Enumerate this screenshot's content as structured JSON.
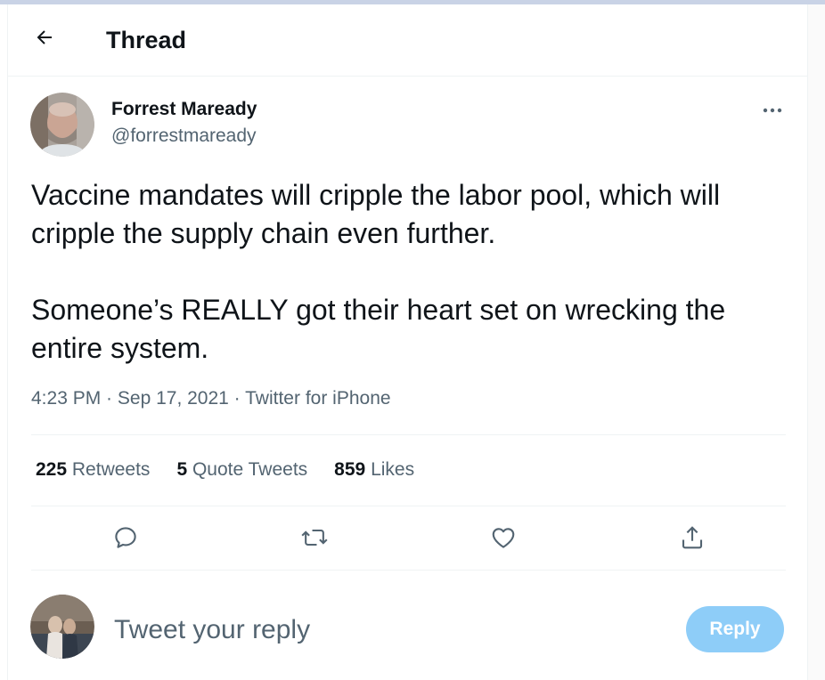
{
  "header": {
    "title": "Thread",
    "back_icon": "arrow-left-icon"
  },
  "tweet": {
    "author_name": "Forrest Maready",
    "author_handle": "@forrestmaready",
    "text_paragraphs": [
      "Vaccine mandates will cripple the labor pool, which will cripple the supply chain even further.",
      "Someone’s REALLY got their heart set on wrecking the entire system."
    ],
    "time": "4:23 PM",
    "date": "Sep 17, 2021",
    "separator": " · ",
    "source": "Twitter for iPhone"
  },
  "stats": {
    "retweets_count": "225",
    "retweets_label": "Retweets",
    "quotes_count": "5",
    "quotes_label": "Quote Tweets",
    "likes_count": "859",
    "likes_label": "Likes"
  },
  "actions": {
    "reply_icon": "reply-icon",
    "retweet_icon": "retweet-icon",
    "like_icon": "heart-icon",
    "share_icon": "share-icon"
  },
  "reply_box": {
    "placeholder": "Tweet your reply",
    "button_label": "Reply"
  },
  "colors": {
    "text_primary": "#0f1419",
    "text_secondary": "#536471",
    "reply_button_disabled": "#8ecdf8",
    "divider": "#eff3f4"
  }
}
